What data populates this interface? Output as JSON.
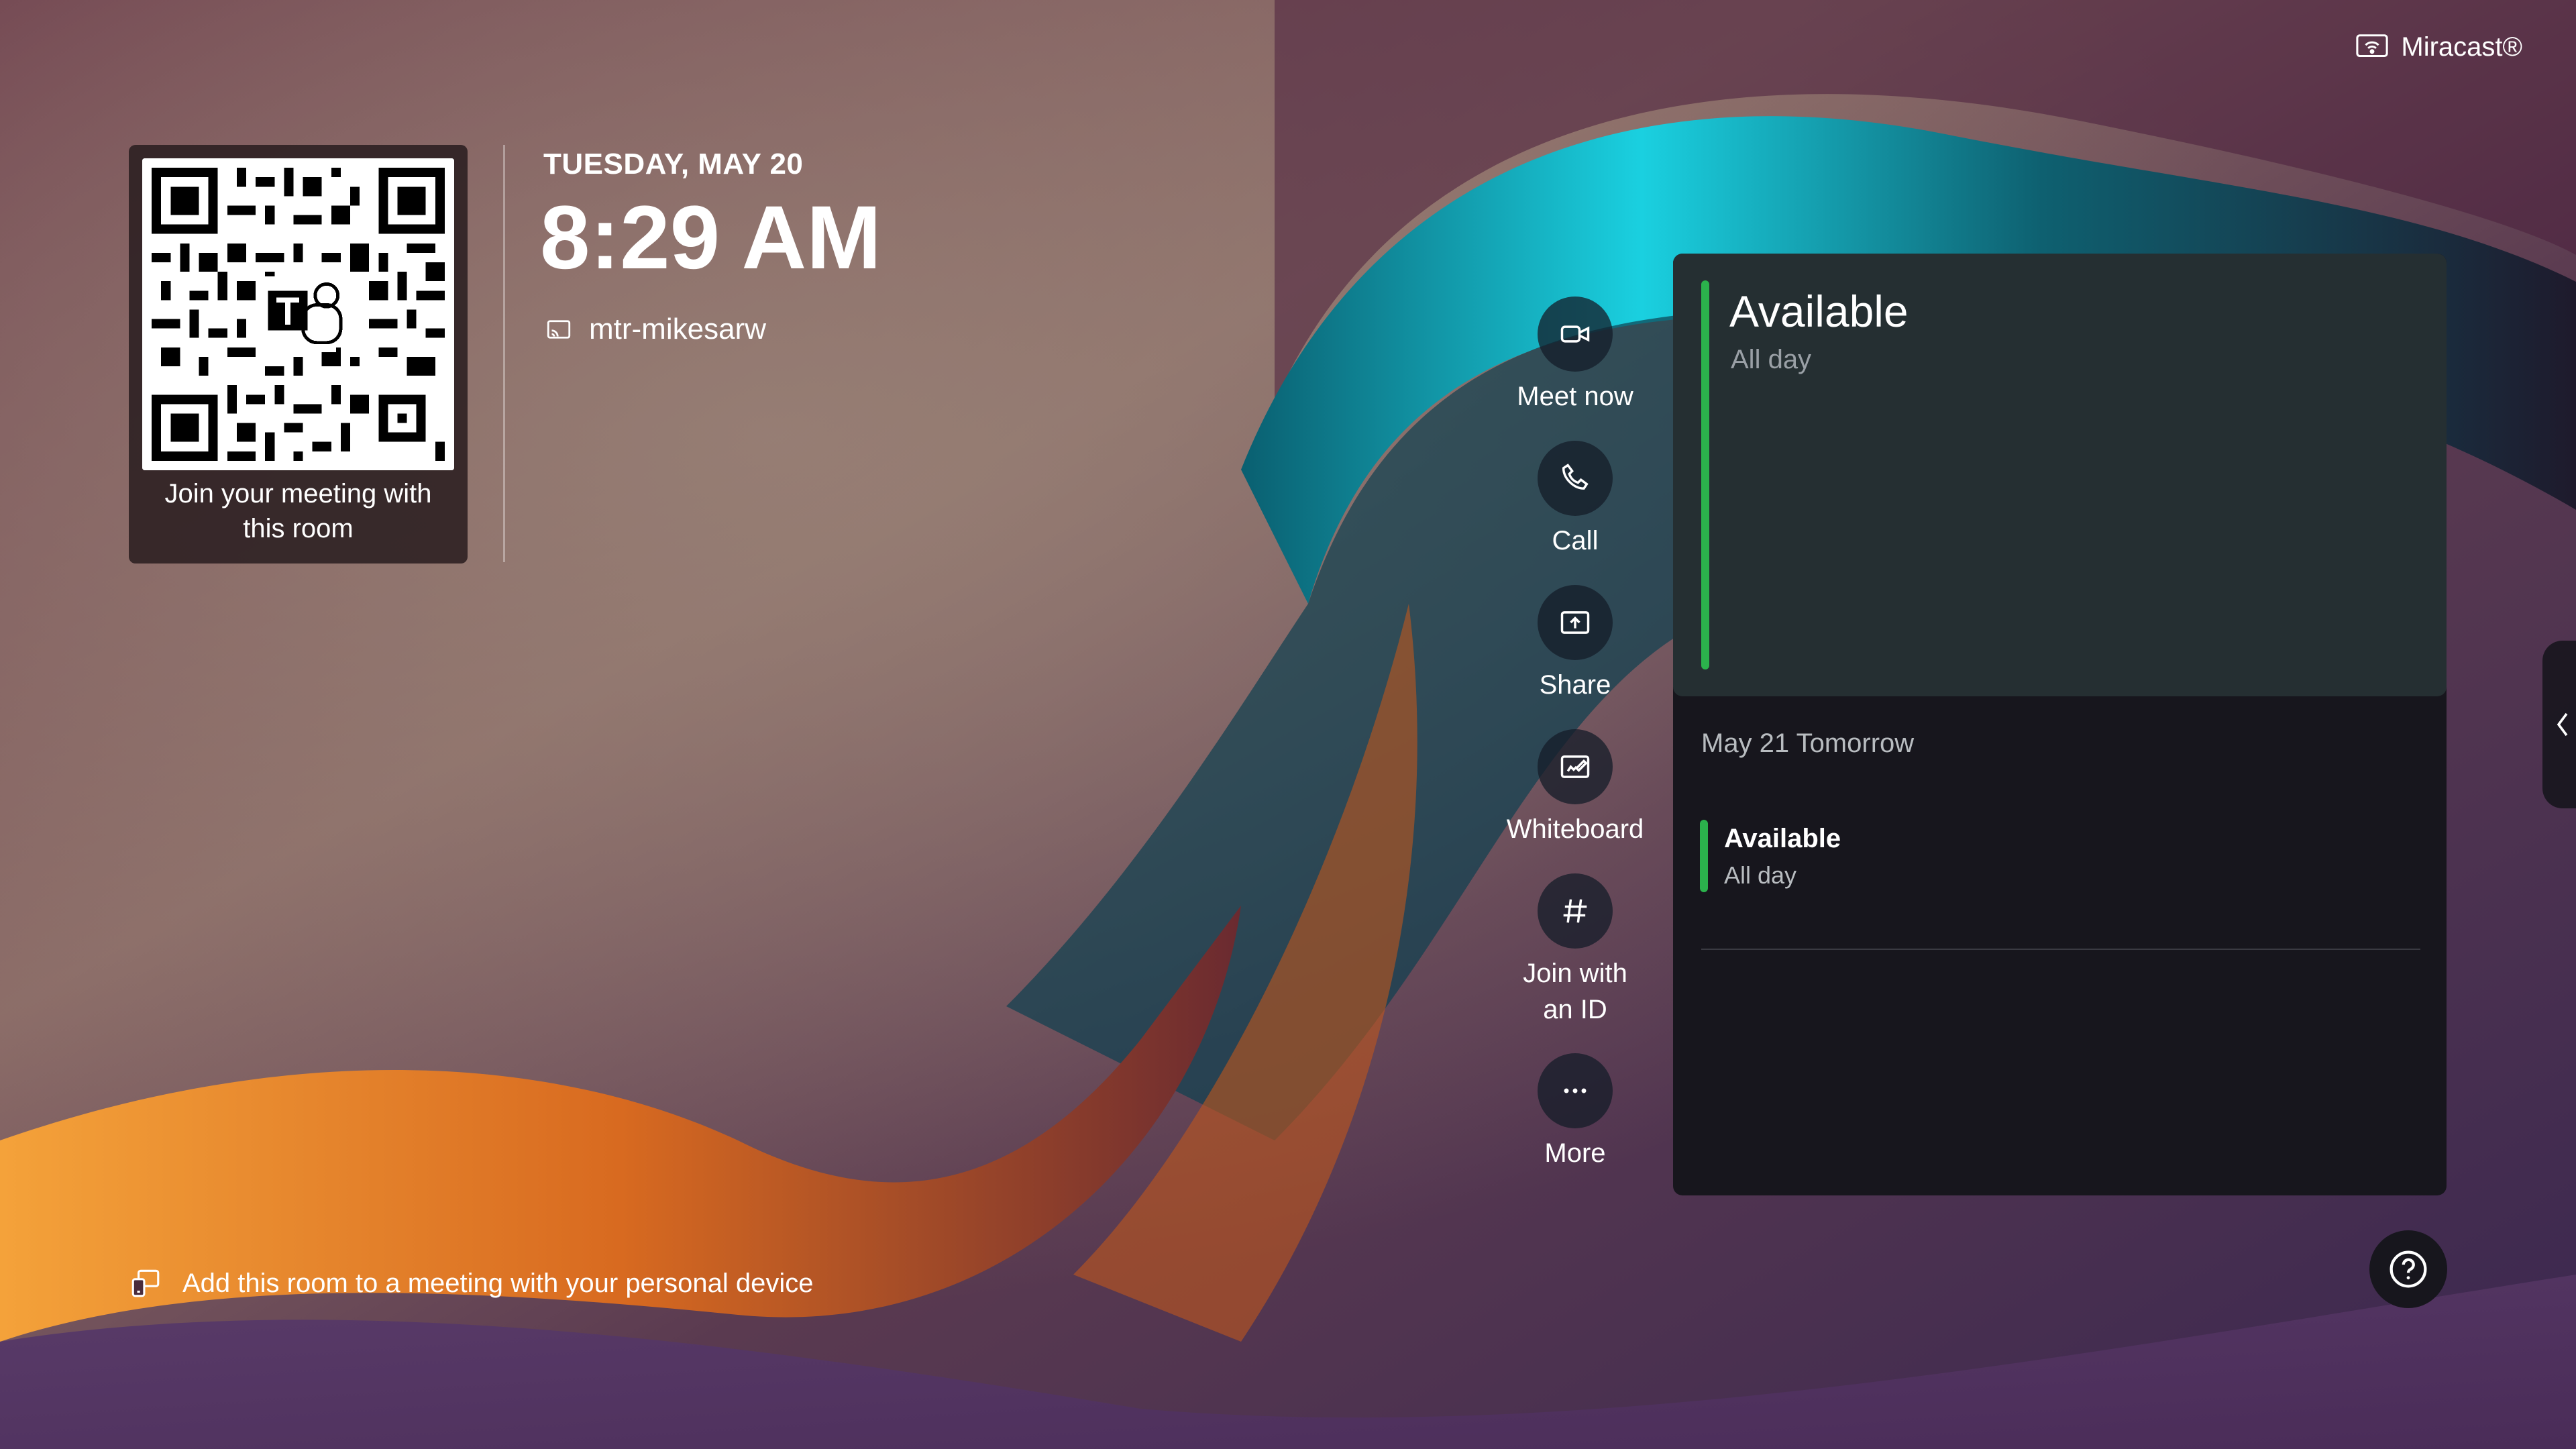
{
  "qr": {
    "caption_line1": "Join your meeting with",
    "caption_line2": "this room",
    "logo": "teams-logo"
  },
  "header": {
    "date": "TUESDAY, MAY 20",
    "time": "8:29 AM",
    "room_name": "mtr-mikesarw",
    "room_icon": "cast-display-icon"
  },
  "miracast": {
    "label": "Miracast®",
    "icon": "miracast-icon"
  },
  "actions": [
    {
      "label": "Meet now",
      "icon": "video-camera-icon"
    },
    {
      "label": "Call",
      "icon": "phone-icon"
    },
    {
      "label": "Share",
      "icon": "share-screen-icon"
    },
    {
      "label": "Whiteboard",
      "icon": "whiteboard-icon"
    },
    {
      "label_line1": "Join with",
      "label_line2": "an ID",
      "icon": "hash-icon"
    },
    {
      "label": "More",
      "icon": "ellipsis-icon"
    }
  ],
  "calendar": {
    "today": {
      "status": "Available",
      "time": "All day"
    },
    "tomorrow_header": "May 21 Tomorrow",
    "tomorrow_event": {
      "status": "Available",
      "time": "All day"
    },
    "accent_color": "#2bb24c"
  },
  "footer": {
    "personal_device_text": "Add this room to a meeting with your personal device",
    "personal_device_icon": "device-cast-icon",
    "help_icon": "question-icon",
    "side_tab_icon": "chevron-left-icon"
  }
}
